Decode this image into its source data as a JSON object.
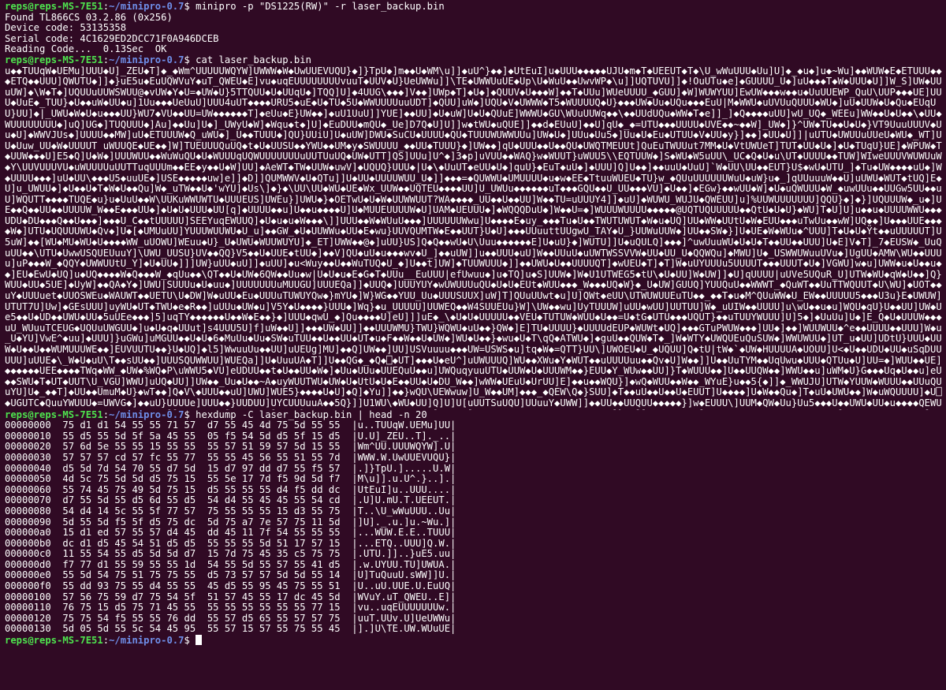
{
  "prompt": {
    "user_host": "reps@reps-MS-7E51",
    "sep": ":",
    "path": "~/minipro-0.7",
    "symbol": "$ "
  },
  "cmd1": {
    "command": "minipro -p \"DS1225(RW)\" -r laser_backup.bin"
  },
  "output1": [
    "Found TL866CS 03.2.86 (0x256)",
    "Device code: 53135358",
    "Serial code: 4C1629ED2DCC71F0A946DCEB",
    "Reading Code...  0.13Sec  OK"
  ],
  "cmd2": {
    "command": "cat laser_backup.bin"
  },
  "cat_output": "u◆◆TUUqW◆UEMu]UUU◆U]_ZEU◆T]◆_◆Wm^UUUUUWQYW]UWWW◆W◆UwUUEVUQU}◆]}TpU◆]m◆◆U◆WM\\u]]◆uU^}◆◆]◆UtEuI]u◆UUU◆◆◆◆◆UJU◆m◆T◆UEEUT◆T◆\\U_wWuUUU◆Uu]U]◆_◆u◆]u◆~Wu]◆◆WUW◆E◆ETUUU◆◆◆ETQ◆◆UUU]QWUTU◆]]◆}uE5u◆EuUQWVuY◆uT_QWEU◆E]vu◆uqEUUUUUUUUvuuT◆UUV◆U}UeUWWu]]\\TE◆UWWUuUE◆Up\\U◆WuU◆◆UwvWP◆\\u]]UQTUVU]]◆!OuUTu◆e]◆GUUUU_U◆]uU◆◆◆T◆W◆UUU◆U]]W_S]UW◆UUuUW]◆\\W◆T◆]UQUUuUUWSWUU@◆vUW◆Y◆U=◆UW◆U}5TTQUU◆U◆UUqU◆]TQQ]U]◆4UUG\\◆◆◆]V◆◆]UWp◆T]◆U◆]◆QUUV◆U◆◆◆W]◆◆T◆UUu]WUeUUUU_◆GUU]◆W]WUWYUU]EwUW◆◆◆w◆◆u◆UuUUEWP_QuU\\UUP◆◆◆UE]UUU◆UuE◆_TUU}◆U◆◆uW◆UU◆u]1Uu◆◆◆UeUuU]UUU4uUT◆◆◆◆URU5◆uE◆U◆TU◆5U◆WWUUUUuuUDT]◆QUU]uW◆]UQU◆V◆UWWW◆T5◆WUUUUQ◆U}◆◆◆UW◆Uu◆UQu◆◆◆EuU|M◆WWU◆uUVUuQUUU◆WU◆]uU◆UUW◆U◆Qu◆EUqUU}UU]◆|_UWU◆W◆U◆u◆◆◆UU}WU7◆VU◆◆UU=UW◆◆◆◆◆◆T]◆eUu◆E}UW◆◆]◆uU1UuU]]YUE]◆◆UU]◆U◆uW]U◆U◆QUuE]WWWU◆GU\\WUuUUWq◆◆\\◆◆UUdUQu◆WW◆T◆e]]_]◆Q◆◆◆◆uUU]wU_UQ◆_WEEu]WW◆◆U◆U◆◆\\◆UU◆WUUUUUUUU◆]uQ]UG◆]TUQUUU◆]Au]◆◆Uu]U◆]_UWyU◆W]◆Wqu◆t◆]U]◆EuDUU◆mQU◆_Ue]D7Q◆U]U]]w◆tWU◆uQUE]]◆◆d◆EUuU]◆◆U]qU◆_◆=UTU◆◆◆UUUU◆UVE◆◆~◆◆W]_UW◆]}^UW◆TU◆◆U◆U◆}VT9UuuUUUV◆Uu◆U]◆WWVJUs◆]UUUU◆◆MW]uU◆ETUUUW◆Q_uWU◆]_U◆◆TUUU◆]QU}UUiU]U◆uUW]DWU◆SuCU◆UUUU◆QU◆TUUUWUWWUUu]UW◆U◆]UUu◆Uu5◆]Uu◆U◆Eu◆UTUU◆V◆UU◆y}]◆◆]◆UU◆U]]|uUTU◆UWUUuUUeU◆WU◆_WT]UU◆Uuw_UU◆W◆UUUUT uWUUQE◆UE◆◆]W]TUEUUUQuUQ◆t◆U◆UUSU◆◆YWU◆◆UM◆y◆SWUUUU_◆◆UU◆TUUU}◆]UW◆◆]qU◆UUU◆◆U◆◆QU◆UWQTMEUUt]QuEuTWUUut7MM◆U◆VtUWUeT]TUT◆UU◆U◆]◆U◆TUqU}UE]◆WPUW◆T◆UUW◆◆◆U]E5◆Q]U◆W◆]UUUWUU◆◆WuWuQU◆U◆WUUUqUQWUUUUUUUuUUTUuUQ◆UW◆UTT]QS]UUu]U^◆]3◆p]uVUU◆◆WAQ}w◆WUUT}uWUU5\\\\EQTUUW◆]S◆WU◆W5uUU\\_UC◆Q◆U◆u\\UT◆UUUU◆◆TUW]WIweUUUVWUWUuW◆Y\\UUVUUUVU◆uWUUUUuUUTTuqUUUm◆◆EE◆y◆◆U◆W]UU]◆AeWT◆TW◆UUW◆uwV]◆UQUQ}UUU◆|U◆\\◆UuUT◆eUU◆U◆]quU}◆EuT◆uU◆]◆UUU]Q]U◆◆]◆◆uuU◆UuU]`W◆UU\\UU◆◆EUT}U$◆wU◆UTU_]◆Tu◆UW◆◆◆◆uU◆]W◆UUUU◆◆◆]uU◆UU\\◆◆◆U5◆uuUE◆]USE◆◆◆◆◆uw]e]]◆D]]QUMWWV◆U◆QTu]]U◆UU◆UUUUWUU_U◆]]◆◆◆=◆QUWWU◆UMUUUU◆u◆w◆EE◆TtuuWUEU◆TU}w_◆QUuUUUUUUWuU◆uW}u◆_]qUUuuuW◆◆U]uUWU◆WUT◆tUQ]E◆U]u_UWUU◆]◆U◆◆U◆T◆W◆U◆◆Qu]W◆_uTW◆◆U◆'wYU]◆Us\\]◆}◆\\UU\\UU◆WU◆UE◆Wx_UUW◆◆UQTEU◆◆◆◆UU]U_UWUu◆◆◆◆◆◆uT◆◆◆GQU◆◆U_UU◆◆◆VU]◆U◆◆]◆EGw}◆◆wUU◆W]◆U◆uQWUUU◆W_◆uwUUu◆◆UUGw5UU◆◆uU]WQUTT◆◆◆◆TUQE◆u}u◆UuU◆◆W\\UUKuWWUWTU◆UUUEUS]UWEu}]UWU◆}◆OETwU◆U◆W◆UUWWUUT?WA◆◆◆◆_UU◆◆U◆◆UU]W◆◆TU=uUUUY4]]◆uU]◆WUWU_WUJU◆QWEUU]u]%UUWUUUUUUU]QQU}◆]◆}]UQUUUW◆_u◆]UE◆◆Q◆◆UU◆◆UUUUW_W◆◆E◆◆◆UU◆]◆U◆U◆UUU◆UU[q]◆UUUU◆◆u]U◆◆u◆◆◆◆U]U◆MUUEUUUUW◆U]UAM◆UEUUU◆]◆WQQQDuU◆]W◆◆U=◆]WUUUWUUUU◆◆◆◆◆@UQTUQUUUUU◆◆QtU◆U◆U}◆WU]T◆U]U]u◆◆u◆UUUUWWU◆◆◆UDU◆DU◆◆◆Q◆◆U◆◆◆]◆◆◆U_C◆◆tUUUUU]SEEYuqEWUUQ]◆U◆u◆u◆W◆◆◆\\]]UUU◆◆W◆WUuU◆◆◆]UUUUUUWwu]U◆◆◆◆E◆uy_◆◆◆Tu◆U◆◆TWUTUWUT◆W◆u◆UQ]UU◆WW◆UUtU◆W◆EUU◆◆◆uTwUu◆◆wW]UQ◆◆]U◆◆◆UUE◆◆◆◆W◆]UTU◆UQUUUWU◆Qv◆]U◆[◆UMUuUU]YUUUWUUWU◆U_u]◆◆GW_◆U◆UUWWu◆UU◆E◆wu}UUVQUMTW◆E◆◆UUT}U◆U]◆◆◆UUuuttUUgwU_TAY◆U_}UUWuUUW◆]UU◆◆SW◆}]U◆UE◆W◆WUu◆^UUU]T◆U◆U◆Ÿt◆◆uUUUUUT]U5uW]◆◆[WU◆MU◆WU◆U◆◆◆◆WW_uUOWU]WEuu◆U}_U◆UWU◆WUUWUYU]◆_ET]UWW◆◆@◆]uUU}US]Q◆Q◆◆wU◆U\\Uuu◆◆◆◆◆◆E]U◆uU}◆]WUTU]]U◆uQULQ]◆◆◆]^uwUuuWU◆U◆U◆T◆◆UU◆◆UUU]U◆E]V◆T]_7◆EUSW◆_UuQuUU◆◆\\UTU◆UwwUSQUEUuuY]\\UWU_UUSU}UV◆◆QQ}V5◆◆U◆UUE◆tUU◆]◆◆V]QU◆uU◆u◆◆◆wv◆U_]◆◆uUW]]u◆◆UUU◆uU]W◆◆UUuU◆uUWTWSSVVW◆UU◆UU_U◆QQWQu]◆MWU]U◆_USWWUWuuUVu◆]UgUU◆AMW\\WU◆◆UUUu]uP◆◆◆W_◆QQY◆UWWUUtU_Y]◆U◆UU◆]]]UW}uUU◆uU]]◆uUU]◆u<Wuy◆◆U◆◆WuTUQ◆U_◆]U◆◆t]UW]◆TUUWUUU◆]]◆◆UWU◆U◆◆UUUUQT]◆wUEU◆T]◆T]W◆uUYUUUu5UUUUT◆◆◆UUUT◆U◆]VGWU]w◆u]UWW◆u◆U◆◆u◆◆]EU◆EwU◆UQ]u◆UQ◆◆◆◆W◆Q◆◆◆W_◆qUu◆◆\\QT◆◆U◆UW◆6QW◆◆Uu◆w|U◆U◆u◆E◆G◆T◆UUu__EuUUU|efUwuu◆]u◆TQ]u◆S]UUW◆]W◆U1UTWEG5◆tU\\◆U◆UU]W◆UW]]◆U]qUUUU|uUVe5UQuR_U]UTW◆WU◆qW◆U◆◆]Q}WUU◆UU◆5UE]◆UyW]◆◆QA◆Y◆]UWU|SUUUu◆U◆uu◆]UUUUUUUuMUUGU]UUUEQa]]◆UUQ◆]UUUYUY◆wUWUUUuQU◆U◆U◆EUt◆WUU◆◆◆_W◆◆◆UQ◆W}◆_U◆UW]GUUQ]YUUQuU◆◆WWWT_◆QuWT◆◆UuTTWQUUT◆U\\WU]◆UOT◆◆uY◆UUUuet◆UUOSWEu◆WAUWT◆◆UETU\\U◆DW]W◆uUU◆Eu◆UUUuTUWUYQw◆}mYU◆]W}WG◆◆YUU_Uu◆UUUSUUX]uW]T]QUuUUwt◆u]U]QWt◆eUU\\UTWUWUUEuTU◆◆_◆◆T◆u◆M^QUuWW◆U_EW◆◆UUUUU5◆◆◆U3u}E◆UWUW]UTUT7U]Uw]◆GEsUUU]uyWU◆UT◆TWU◆e◆R◆◆]uUUu◆UW◆u]V5Y◆U◆◆◆◆}UUU◆]Wq}◆u_UUUUU]UUWEQ◆◆W4SUUEUu}W]\\UW◆◆wu]UyTUUUW]uUU◆wUU]UUTUU]W◆_uUIW◆◆UUUU]u\\wU◆◆u◆u]WQU◆qU}U◆◆UU]UW◆Ue5◆◆U◆UD◆◆UWU◆UU◆5uUEe◆◆◆]5]uqTY◆◆◆◆◆◆U◆◆W◆E◆◆}◆]UUU◆qwU_◆]Qu◆◆◆◆U]eU]]]uE◆_\\◆U◆U◆UUUUU◆◆VEU◆TUTUW◆WUU◆U◆◆=U◆tG◆UTU◆◆◆UQUT}◆◆uTUUYWUUU]U]5◆]◆UuUu]U◆]E_Q◆U◆UUUW◆◆◆uU_WUuuTCEUG◆UQUuUWGUU◆]u◆U◆q◆UUut]s4UUU5U]f]uW◆◆U]]◆◆◆UW◆UU]]◆◆UUUWMU}TWU}WQWU◆uU◆◆}QW◆]E]TU◆UUUU}◆UUUUdEUP◆WUWt◆UQ]◆◆◆GTuPWUW◆◆◆]UU◆]◆◆]WUUWUU◆^e◆◆UUUU◆◆UUU]W◆u_U◆YU]VwE^◆uu]◆UUU]}uGWu]uMGUU◆◆U◆U◆6◆MuUu◆Uu◆SW◆uTUU◆◆U◆◆UU◆UT◆u◆F◆◆W◆◆U◆UW◆]WU◆U◆◆}◆wu◆U◆T\\qQ◆ATWU◆]◆guU◆◆QUW◆T◆_]W◆WTY◆UWQUEuQuSUW◆]WWUWUU◆]UT_u◆UU]UDtU}UUU◆UUW◆U◆◆U◆◆WUMUUUWE◆◆]EUVUUTU◆◆}U◆UQ]◆l5]WwuuUu◆◆UU]uUEUg]MU]◆◆Q]UW◆◆]UU]USVuuuu◆◆◆UW=USWS◆u]tq◆W◆=QTT}UU\\]UWOEU◆U_◆UQUU]Q◆tU|tW◆`◆UW◆HUUUUA◆UOUU]U<◆U◆◆UDU◆UU◆uSqDUUUUU]uUUE◆\\_W◆U◆uU\\T◆◆sUU◆◆]UUUSQUWWUU]WUEQa]]U◆UuuUA◆T]]U◆◆QG◆_◆Q◆⎕◆UT]◆◆◆U◆eU^]uUWUUUQ]WU◆◆XWu◆Y◆WUT◆◆uUUUUuu◆◆Qv◆U]W◆◆]]U◆◆UuTYM◆◆UqUwu◆UUU◆QTUu◆U]UU=◆]WUU◆◆UE]◆◆◆◆◆◆UEE◆◆◆◆TWq◆WW_◆UW◆%WQ◆P\\uWWU5◆VU]eUDUU◆◆t◆U◆◆UU◆W◆]◆Uu◆UUu◆UUEQuU◆◆u]UWQuqyuuUTU◆UUW◆U◆UUUWM◆◆}EUU◆Y_WUw◆◆UU]}T◆WUUU◆◆]U◆◆UUQW◆◆]WWU◆◆u]uWM◆U}G◆◆◆Uq◆U◆◆u]eU◆◆SWU◆T◆UT◆UUT\\U_VGU]WWU]uUQ◆UU]]UW◆◆_Uu◆U◆◆~A◆uyWUUTWU◆UW◆U◆UtU◆U◆E◆◆UU◆U◆DU_W◆◆]wWW◆UEuU◆UrUU]E]◆◆u◆◆WQU}]◆wQ◆WUU◆◆W◆◆_WYuE}u◆◆5{◆]]◆_WWUJU]UTW◆YUUW◆WUUU◆◆UUuQUuYU]U◆_◆◆T]◆UU◆◆UmuM◆U}◆wT◆◆]Q◆V\\◆UUU◆◆uU]UWU]WUE5}◆◆◆◆U◆U]◆Q]◆Yu]]◆◆}wQU\\UEWwuw]U_W◆◆UM]◆◆◆_◆QEW\\Q◆}SUU]◆T◆◆uU◆◆U◆◆U◆EUUT]U◆◆◆◆]U◆W◆◆Qu◆]T◆uU◆UWU◆◆]W◆uWQUUUU]◆U⎕◆UGUTC◆QuuYWUUU◆=UWVG◆]◆◆uU}UUUUe]UUU◆◆}UUDUU]UYCUUUuuA◆◆5Q}]]U1WU\\◆WU◆UU]Q]U]U[uUUTSuUQU]UUuuY◆UWW]]◆◆UU◆◆UUQUU◆◆◆◆◆}]w◆EUUU\\]UUM◆QW◆Uu}Uu5◆◆◆U◆◆UWU◆UU◆u◆◆◆◆QEWUUUUWY◆◆◆◆◆◆WU\\EUUU◆U◆Uq◆◆◆◆W]]WQ◆u◆◆WU]u_U◆tU◆]WWuT}Uu◆U5◆◆UUUWWUWMWU◆◆◆UT]U_◆uE]◆◆◆SQU◆W◆EWU◆U◆◆UU◆UUUEU]}uU]]WU◆UUEU◆◆]U◆UTU◆UUUU◆◆UU◆EU_7_UWU]tUu◆U◆◆_W◆WYU◆]VQUUWU◆◆◆◆U◆U◆◆WU◆◆u◆W◆E?◆u◆U◆◆U]EU]Ow◆◆◆WUUS]]◆U◆]T◆_UU◆uETUuuU]W◆UTU◆W◆WW◆◆◆]]UUu◆◆◆◆UqWW◆_U◆◆◆◆UuuUUUUuuUYUUUUU}U◆◆◆◆QU◆U◆]◆w_U◆◆uUU◆◆◆◆◆U]_U◆◆uUW◆◆QWuU◆}U◆◆UWU◆UU◆U◆U\\EUU◆U◆◆u]WW]WTU◆WUt]UUT_UUUOWUu}]◆uY}UuUW◆]◆]WuU_u◆|YU◆◆UuU◆◆WG]U]◆U◆UUUUE◆◆]WUuWUu◆◆UUUUUUU]7u◆UUTTu◆UQ]◆◆◆◆◆uUWUUSWs_U_WQ◆]uQ◆U◆◆◆◆TuU]U◆◆uUUUUE◆]◆UT◆Q]◆◆U◆UQEU]U]eUuQ]◆◆◆wuU◆]UUTuWQWU◆UUW◆◆◆UU_]u=W_sUUUWW◆◆TGUuQU[EU◆Um◆U◆WWU◆mWUUUu◆UUWU◆◆E◆◆TT]U◆U]UUUu◆WU◆UUUU◆◆UW5◆}◆]_d_U]_UMwU}WW◆UuuU◆◆WUWU◆Q`◆◆Uu}U_E]E◆UUeuWu_uW◆EWUU◆uUW◆WUUW]eU]U5U]◆UW◆◆◆U◆M◆PWUUUU◆◆}_UWW◆◆WWUUUUUUUUY]◆◆u◆UU◆U]u◆UUUUW◆UTW_U",
  "cmd3": {
    "command": "hexdump -C laser_backup.bin | head -n 20"
  },
  "hexdump": [
    {
      "offset": "00000000",
      "hex1": "75 d1 d1 54 55 55 71 57",
      "hex2": "d7 55 45 4d 75 5d 55 55",
      "ascii": "|u..TUUqW.UEMu]UU|"
    },
    {
      "offset": "00000010",
      "hex1": "55 d5 55 5d 5f 5a 45 55",
      "hex2": "05 f5 54 5d d5 5f 15 d5",
      "ascii": "|U.U]_ZEU..T]._..|"
    },
    {
      "offset": "00000020",
      "hex1": "57 6d 5e 55 55 15 55 55",
      "hex2": "55 57 51 59 57 5d 15 55",
      "ascii": "|Wm^UU.UUUWQYW].U|"
    },
    {
      "offset": "00000030",
      "hex1": "57 57 57 cd 57 fc 55 77",
      "hex2": "55 55 45 56 55 51 55 7d",
      "ascii": "|WWW.W.UwUUEVUQU}|"
    },
    {
      "offset": "00000040",
      "hex1": "d5 5d 7d 54 70 55 d7 5d",
      "hex2": "15 d7 97 dd d7 55 f5 57",
      "ascii": "|.]}TpU.].....U.W|"
    },
    {
      "offset": "00000050",
      "hex1": "4d 5c 75 5d 5d d5 75 15",
      "hex2": "55 5e 17 7d f5 9d 5d f7",
      "ascii": "|M\\u]].u.U^.}..].|"
    },
    {
      "offset": "00000060",
      "hex1": "55 74 45 75 49 5d 75 15",
      "hex2": "d5 55 55 55 d4 f5 dd dc",
      "ascii": "|UtEuI]u..UUU....|"
    },
    {
      "offset": "00000070",
      "hex1": "d7 55 5d 55 d5 6d 55 d5",
      "hex2": "54 d4 55 45 45 55 54 cd",
      "ascii": "|.U]U.mU.T.UEEUT.|"
    },
    {
      "offset": "00000080",
      "hex1": "54 d4 14 5c 55 5f 77 57",
      "hex2": "75 55 55 55 15 d3 55 75",
      "ascii": "|T..\\U_wWuUUU..Uu|"
    },
    {
      "offset": "00000090",
      "hex1": "5d 55 5d f5 5f d5 75 dc",
      "hex2": "5d 75 a7 7e 57 75 11 5d",
      "ascii": "|]U]._.u.]u.~Wu.]|"
    },
    {
      "offset": "000000a0",
      "hex1": "15 d1 ed 57 55 57 d4 45",
      "hex2": "dd 45 11 7f 54 55 55 55",
      "ascii": "|...WUW.E.E..TUUU|"
    },
    {
      "offset": "000000b0",
      "hex1": "dc d1 d5 45 54 51 d5 d5",
      "hex2": "55 55 55 5d 51 17 57 15",
      "ascii": "|...ETQ..UUU]Q.W.|"
    },
    {
      "offset": "000000c0",
      "hex1": "11 55 54 55 d5 5d 5d d7",
      "hex2": "15 7d 75 45 35 c5 75 75",
      "ascii": "|.UTU.]]..}uE5.uu|"
    },
    {
      "offset": "000000d0",
      "hex1": "f7 77 d1 55 59 55 55 1d",
      "hex2": "54 55 5d 55 57 55 41 d5",
      "ascii": "|.w.UYUU.TU]UWUA.|"
    },
    {
      "offset": "000000e0",
      "hex1": "55 5d 54 75 51 75 75 55",
      "hex2": "d5 73 57 57 5d 5d 55 14",
      "ascii": "|U]TuQuuU.sWW]]U.|"
    },
    {
      "offset": "000000f0",
      "hex1": "55 dd 93 75 55 d4 55 55",
      "hex2": "45 d5 55 95 45 75 55 51",
      "ascii": "|U..uU.UUE.U.EuUQ|"
    },
    {
      "offset": "00000100",
      "hex1": "57 56 75 59 d7 75 54 5f",
      "hex2": "51 57 45 55 17 dc 45 5d",
      "ascii": "|WVuY.uT_QWEU..E]|"
    },
    {
      "offset": "00000110",
      "hex1": "76 75 15 d5 75 71 45 55",
      "hex2": "55 55 55 55 55 55 77 15",
      "ascii": "|vu..uqEUUUUUUUw.|"
    },
    {
      "offset": "00000120",
      "hex1": "75 75 54 f5 55 55 76 dd",
      "hex2": "55 57 d5 65 55 57 57 75",
      "ascii": "|uuT.UUv.U]UeUWWu|"
    },
    {
      "offset": "00000130",
      "hex1": "5d 05 5d 55 5c 54 45 95",
      "hex2": "55 57 15 57 55 75 55 45",
      "ascii": "|].]U\\TE.UW.WUuUE|"
    }
  ]
}
